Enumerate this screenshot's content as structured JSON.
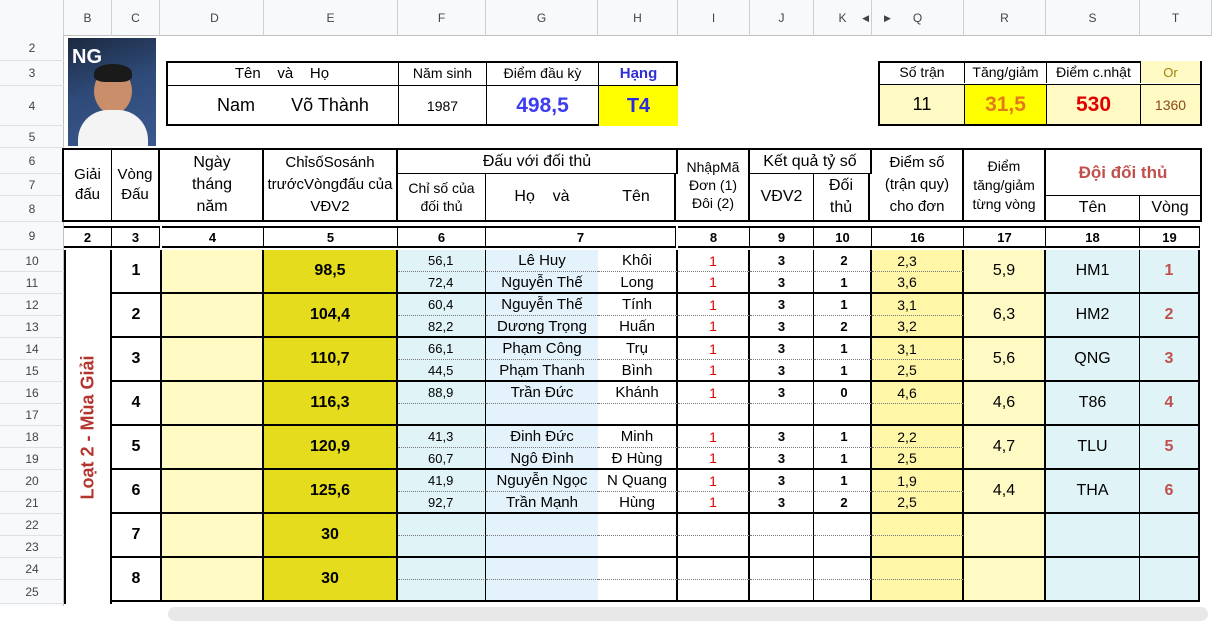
{
  "columns": [
    "B",
    "C",
    "D",
    "E",
    "F",
    "G",
    "H",
    "I",
    "J",
    "K",
    "Q",
    "R",
    "S",
    "T"
  ],
  "rows": [
    "2",
    "3",
    "4",
    "5",
    "6",
    "7",
    "8",
    "9",
    "10",
    "11",
    "12",
    "13",
    "14",
    "15",
    "16",
    "17",
    "18",
    "19",
    "20",
    "21",
    "22",
    "23",
    "24",
    "25"
  ],
  "player": {
    "header_name": "Tên    và    Họ",
    "first": "Nam",
    "last": "Võ Thành",
    "birth_label": "Năm sinh",
    "birth": "1987",
    "start_label": "Điểm đầu kỳ",
    "start": "498,5",
    "rank_label": "Hạng",
    "rank": "T4"
  },
  "summary": {
    "matches_label": "Số trận",
    "matches": "11",
    "change_label": "Tăng/giảm",
    "change": "31,5",
    "updated_label": "Điểm c.nhật",
    "updated": "530",
    "or_label": "Or",
    "or": "1360"
  },
  "headers": {
    "tournament": "Giải đấu",
    "round": "Vòng Đấu",
    "date": "Ngày tháng năm",
    "index": "ChỉsốSosánh trướcVòngđấu của VĐV2",
    "vs": "Đấu với đối thủ",
    "opp_index": "Chỉ số của đối thủ",
    "opp_name_a": "Họ    và",
    "opp_name_b": "Tên",
    "type": "NhậpMã Đơn (1) Đôi (2)",
    "result": "Kết quả tỷ số",
    "vdv2": "VĐV2",
    "opp": "Đối thủ",
    "score": "Điểm số (trận quy) cho đơn",
    "delta": "Điểm tăng/giảm từng vòng",
    "team": "Đội đối thủ",
    "team_name": "Tên",
    "team_round": "Vòng",
    "nums": [
      "2",
      "3",
      "4",
      "5",
      "6",
      "7",
      "8",
      "9",
      "10",
      "16",
      "17",
      "18",
      "19"
    ]
  },
  "season_label": "Loạt 2 - Mùa Giải",
  "rounds": [
    {
      "n": "1",
      "idx": "98,5",
      "delta": "5,9",
      "team": "HM1",
      "tr": "1",
      "m": [
        {
          "oi": "56,1",
          "a": "Lê Huy",
          "b": "Khôi",
          "t": "1",
          "v": "3",
          "o": "2",
          "s": "2,3"
        },
        {
          "oi": "72,4",
          "a": "Nguyễn Thế",
          "b": "Long",
          "t": "1",
          "v": "3",
          "o": "1",
          "s": "3,6"
        }
      ]
    },
    {
      "n": "2",
      "idx": "104,4",
      "delta": "6,3",
      "team": "HM2",
      "tr": "2",
      "m": [
        {
          "oi": "60,4",
          "a": "Nguyễn Thế",
          "b": "Tính",
          "t": "1",
          "v": "3",
          "o": "1",
          "s": "3,1"
        },
        {
          "oi": "82,2",
          "a": "Dương Trọng",
          "b": "Huấn",
          "t": "1",
          "v": "3",
          "o": "2",
          "s": "3,2"
        }
      ]
    },
    {
      "n": "3",
      "idx": "110,7",
      "delta": "5,6",
      "team": "QNG",
      "tr": "3",
      "m": [
        {
          "oi": "66,1",
          "a": "Phạm Công",
          "b": "Trụ",
          "t": "1",
          "v": "3",
          "o": "1",
          "s": "3,1"
        },
        {
          "oi": "44,5",
          "a": "Phạm Thanh",
          "b": "Bình",
          "t": "1",
          "v": "3",
          "o": "1",
          "s": "2,5"
        }
      ]
    },
    {
      "n": "4",
      "idx": "116,3",
      "delta": "4,6",
      "team": "T86",
      "tr": "4",
      "m": [
        {
          "oi": "88,9",
          "a": "Trần Đức",
          "b": "Khánh",
          "t": "1",
          "v": "3",
          "o": "0",
          "s": "4,6"
        },
        {
          "oi": "",
          "a": "",
          "b": "",
          "t": "",
          "v": "",
          "o": "",
          "s": ""
        }
      ]
    },
    {
      "n": "5",
      "idx": "120,9",
      "delta": "4,7",
      "team": "TLU",
      "tr": "5",
      "m": [
        {
          "oi": "41,3",
          "a": "Đinh Đức",
          "b": "Minh",
          "t": "1",
          "v": "3",
          "o": "1",
          "s": "2,2"
        },
        {
          "oi": "60,7",
          "a": "Ngô Đình",
          "b": "Đ Hùng",
          "t": "1",
          "v": "3",
          "o": "1",
          "s": "2,5"
        }
      ]
    },
    {
      "n": "6",
      "idx": "125,6",
      "delta": "4,4",
      "team": "THA",
      "tr": "6",
      "m": [
        {
          "oi": "41,9",
          "a": "Nguyễn Ngọc",
          "b": "N Quang",
          "t": "1",
          "v": "3",
          "o": "1",
          "s": "1,9"
        },
        {
          "oi": "92,7",
          "a": "Trần Mạnh",
          "b": "Hùng",
          "t": "1",
          "v": "3",
          "o": "2",
          "s": "2,5"
        }
      ]
    },
    {
      "n": "7",
      "idx": "30",
      "delta": "",
      "team": "",
      "tr": "",
      "m": [
        {
          "oi": "",
          "a": "",
          "b": "",
          "t": "",
          "v": "",
          "o": "",
          "s": ""
        },
        {
          "oi": "",
          "a": "",
          "b": "",
          "t": "",
          "v": "",
          "o": "",
          "s": ""
        }
      ]
    },
    {
      "n": "8",
      "idx": "30",
      "delta": "",
      "team": "",
      "tr": "",
      "m": [
        {
          "oi": "",
          "a": "",
          "b": "",
          "t": "",
          "v": "",
          "o": "",
          "s": ""
        },
        {
          "oi": "",
          "a": "",
          "b": "",
          "t": "",
          "v": "",
          "o": "",
          "s": ""
        }
      ]
    }
  ]
}
